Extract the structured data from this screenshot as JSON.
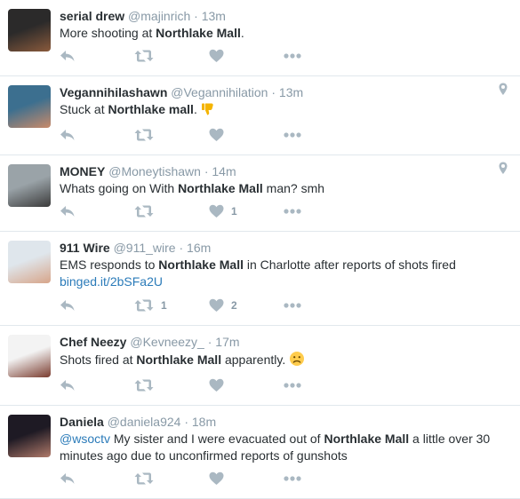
{
  "tweets": [
    {
      "name": "serial drew",
      "handle": "@majinrich",
      "time": "13m",
      "text": [
        {
          "t": "More shooting at "
        },
        {
          "t": "Northlake Mall",
          "b": true
        },
        {
          "t": "."
        }
      ],
      "retweets": "",
      "likes": "",
      "geo": false,
      "avatar_colors": [
        "#2b2a2a",
        "#8a5a3c"
      ]
    },
    {
      "name": "Vegannihilashawn",
      "handle": "@Vegannihilation",
      "time": "13m",
      "text": [
        {
          "t": "Stuck at "
        },
        {
          "t": "Northlake mall",
          "b": true
        },
        {
          "t": ". "
        },
        {
          "emoji": "thumbs-down-emoji"
        }
      ],
      "retweets": "",
      "likes": "",
      "geo": true,
      "avatar_colors": [
        "#3c6f8f",
        "#c98a6a"
      ]
    },
    {
      "name": "MONEY",
      "handle": "@Moneytishawn",
      "time": "14m",
      "text": [
        {
          "t": "Whats going on With "
        },
        {
          "t": "Northlake Mall",
          "b": true
        },
        {
          "t": " man? smh"
        }
      ],
      "retweets": "",
      "likes": "1",
      "geo": true,
      "avatar_colors": [
        "#9aa3a8",
        "#3b3b3b"
      ]
    },
    {
      "name": "911 Wire",
      "handle": "@911_wire",
      "time": "16m",
      "text": [
        {
          "t": "EMS responds to "
        },
        {
          "t": "Northlake Mall",
          "b": true
        },
        {
          "t": " in Charlotte after reports of shots fired"
        },
        {
          "br": true
        },
        {
          "link": "binged.it/2bSFa2U"
        }
      ],
      "retweets": "1",
      "likes": "2",
      "geo": false,
      "avatar_colors": [
        "#dfe6ec",
        "#d7a58a"
      ]
    },
    {
      "name": "Chef Neezy",
      "handle": "@Kevneezy_",
      "time": "17m",
      "text": [
        {
          "t": "Shots fired at "
        },
        {
          "t": "Northlake Mall",
          "b": true
        },
        {
          "t": " apparently. "
        },
        {
          "emoji": "frowning-face-emoji"
        }
      ],
      "retweets": "",
      "likes": "",
      "geo": false,
      "avatar_colors": [
        "#f3f3f3",
        "#7a3b2e"
      ]
    },
    {
      "name": "Daniela",
      "handle": "@daniela924",
      "time": "18m",
      "text": [
        {
          "link": "@wsoctv"
        },
        {
          "t": " My sister and I were evacuated out of "
        },
        {
          "t": "Northlake Mall",
          "b": true
        },
        {
          "t": " a little over 30 minutes ago due to unconfirmed reports of gunshots"
        }
      ],
      "retweets": "",
      "likes": "",
      "geo": false,
      "avatar_colors": [
        "#1e1a24",
        "#b07a6a"
      ]
    }
  ],
  "colors": {
    "icon": "#aab8c2",
    "link": "#2b7bb9",
    "meta": "#8899a6",
    "divider": "#e1e8ed"
  },
  "ui": {
    "dot": "·"
  }
}
